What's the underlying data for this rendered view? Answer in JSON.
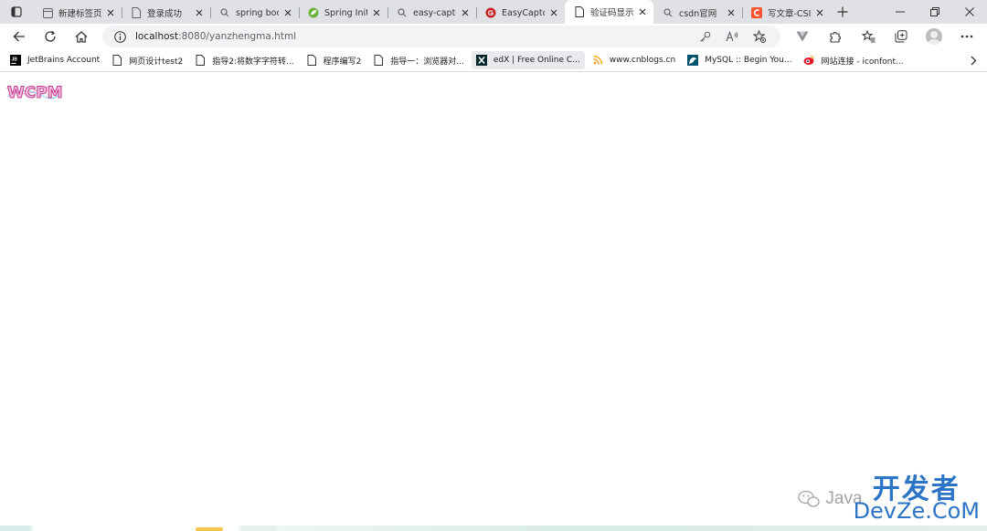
{
  "window": {
    "tabs": [
      {
        "title": "新建标签页",
        "favicon": "newtab-icon",
        "active": false
      },
      {
        "title": "登录成功",
        "favicon": "page-icon",
        "active": false
      },
      {
        "title": "spring boot",
        "favicon": "search-icon",
        "active": false
      },
      {
        "title": "Spring Initi",
        "favicon": "spring-icon",
        "active": false
      },
      {
        "title": "easy-captc",
        "favicon": "search-icon",
        "active": false
      },
      {
        "title": "EasyCaptch",
        "favicon": "gitee-icon",
        "active": false
      },
      {
        "title": "验证码显示",
        "favicon": "page-icon",
        "active": true
      },
      {
        "title": "csdn官网",
        "favicon": "search-icon",
        "active": false
      },
      {
        "title": "写文章-CSI",
        "favicon": "csdn-icon",
        "active": false
      }
    ]
  },
  "toolbar": {
    "url_host": "localhost",
    "url_path": ":8080/yanzhengma.html"
  },
  "bookmarks": [
    {
      "label": "JetBrains Account",
      "icon": "jetbrains-icon"
    },
    {
      "label": "网页设计test2",
      "icon": "page-icon"
    },
    {
      "label": "指导2:将数字字符转...",
      "icon": "page-icon"
    },
    {
      "label": "程序编写2",
      "icon": "page-icon"
    },
    {
      "label": "指导一：浏览器对...",
      "icon": "page-icon"
    },
    {
      "label": "edX | Free Online C...",
      "icon": "edx-icon"
    },
    {
      "label": "www.cnblogs.cn",
      "icon": "cnblogs-icon"
    },
    {
      "label": "MySQL :: Begin You...",
      "icon": "mysql-icon"
    },
    {
      "label": "网站连接 - iconfont...",
      "icon": "iconfont-icon"
    }
  ],
  "content": {
    "captcha_text": "WCPM",
    "watermark": {
      "prefix": "Java",
      "brand_cn": "开发者",
      "brand_en": "DevZe.CoM"
    }
  },
  "colors": {
    "tabstrip": "#dfe1e5",
    "omnibox": "#f1f3f4",
    "watermark_blue": "#1565c0"
  }
}
